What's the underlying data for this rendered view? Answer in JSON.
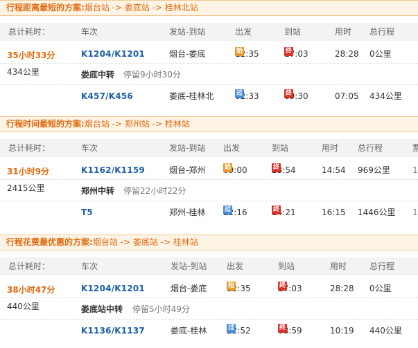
{
  "labels": {
    "transfer": "中转",
    "arrow": "->"
  },
  "columns": [
    "总计耗时：",
    "车次",
    "发站-到站",
    "出发",
    "到站",
    "用时",
    "总行程"
  ],
  "badges": {
    "start": "始",
    "pass": "过",
    "end": "终"
  },
  "plans": [
    {
      "title": "行程距离最短的方案:",
      "route": [
        "烟台站",
        "娄底站",
        "桂林北站"
      ],
      "total_time": "35小时33分",
      "total_distance": "434公里",
      "extra_col": "",
      "transfer_station": "娄底",
      "transfer_wait": "停留9小时30分",
      "legs": [
        {
          "train": "K1204/K1201",
          "stations": "烟台-娄底",
          "dep_type": "start",
          "dep": "12:35",
          "arr_type": "end",
          "arr": "17:03",
          "duration": "28:28",
          "distance": "0公里"
        },
        {
          "train": "K457/K456",
          "stations": "娄底-桂林北",
          "dep_type": "pass",
          "dep": "02:33",
          "arr_type": "end",
          "arr": "09:30",
          "duration": "07:05",
          "distance": "434公里"
        }
      ]
    },
    {
      "title": "行程时间最短的方案:",
      "route": [
        "烟台站",
        "郑州站",
        "桂林站"
      ],
      "total_time": "31小时9分",
      "total_distance": "2415公里",
      "extra_col": "票",
      "transfer_station": "郑州",
      "transfer_wait": "停留22小时22分",
      "legs": [
        {
          "train": "K1162/K1159",
          "stations": "烟台-郑州",
          "dep_type": "start",
          "dep": "09:00",
          "arr_type": "end",
          "arr": "23:54",
          "duration": "14:54",
          "distance": "969公里",
          "extra": "1"
        },
        {
          "train": "T5",
          "stations": "郑州-桂林",
          "dep_type": "pass",
          "dep": "22:16",
          "arr_type": "end",
          "arr": "14:21",
          "duration": "16:15",
          "distance": "1446公里",
          "extra": "1"
        }
      ]
    },
    {
      "title": "行程花费最优惠的方案:",
      "route": [
        "烟台站",
        "娄底站",
        "桂林站"
      ],
      "total_time": "38小时47分",
      "total_distance": "440公里",
      "extra_col": "",
      "transfer_station": "娄底站",
      "transfer_wait": "停留5小时49分",
      "legs": [
        {
          "train": "K1204/K1201",
          "stations": "烟台-娄底",
          "dep_type": "start",
          "dep": "12:35",
          "arr_type": "end",
          "arr": "17:03",
          "duration": "28:28",
          "distance": "0公里"
        },
        {
          "train": "K1136/K1137",
          "stations": "娄底-桂林",
          "dep_type": "pass",
          "dep": "22:52",
          "arr_type": "end",
          "arr": "08:59",
          "duration": "10:19",
          "distance": "440公里"
        }
      ]
    }
  ]
}
